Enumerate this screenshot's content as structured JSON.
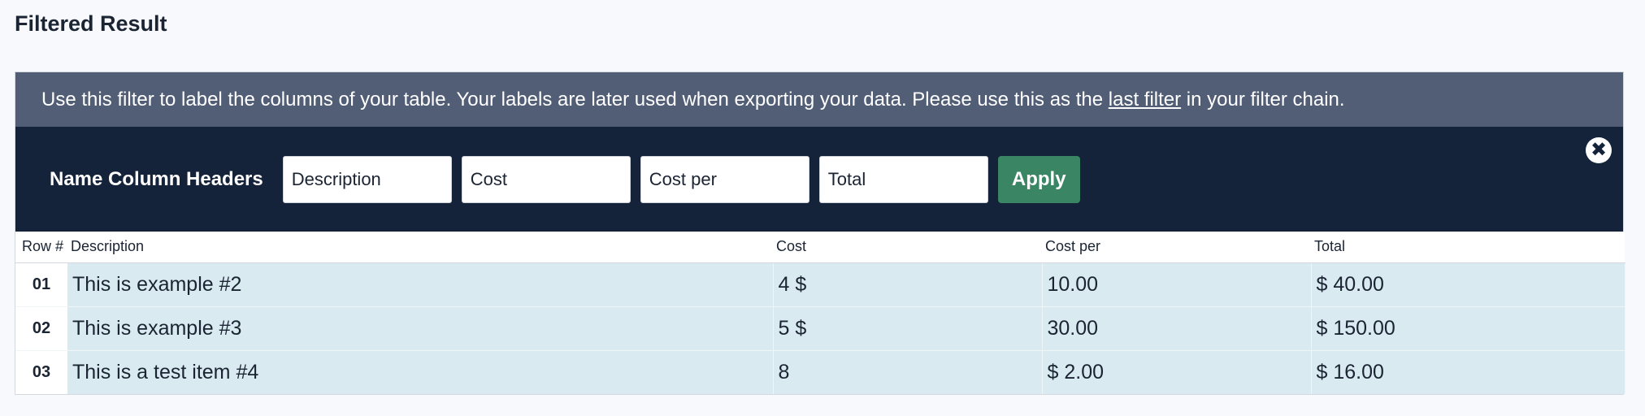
{
  "page": {
    "title": "Filtered Result"
  },
  "info": {
    "text_before": "Use this filter to label the columns of your table. Your labels are later used when exporting your data. Please use this as the ",
    "link": "last filter",
    "text_after": " in your filter chain."
  },
  "filter": {
    "label": "Name Column Headers",
    "inputs": [
      "Description",
      "Cost",
      "Cost per",
      "Total"
    ],
    "apply_label": "Apply",
    "close_icon": "close-icon",
    "close_glyph": "✖"
  },
  "table": {
    "headers": [
      "Row #",
      "Description",
      "Cost",
      "Cost per",
      "Total"
    ],
    "rows": [
      {
        "num": "01",
        "cells": [
          "This is example #2",
          "4 $",
          "10.00",
          "$ 40.00"
        ]
      },
      {
        "num": "02",
        "cells": [
          "This is example #3",
          "5 $",
          "30.00",
          "$ 150.00"
        ]
      },
      {
        "num": "03",
        "cells": [
          "This is a test item #4",
          "8",
          "$ 2.00",
          "$ 16.00"
        ]
      }
    ]
  }
}
